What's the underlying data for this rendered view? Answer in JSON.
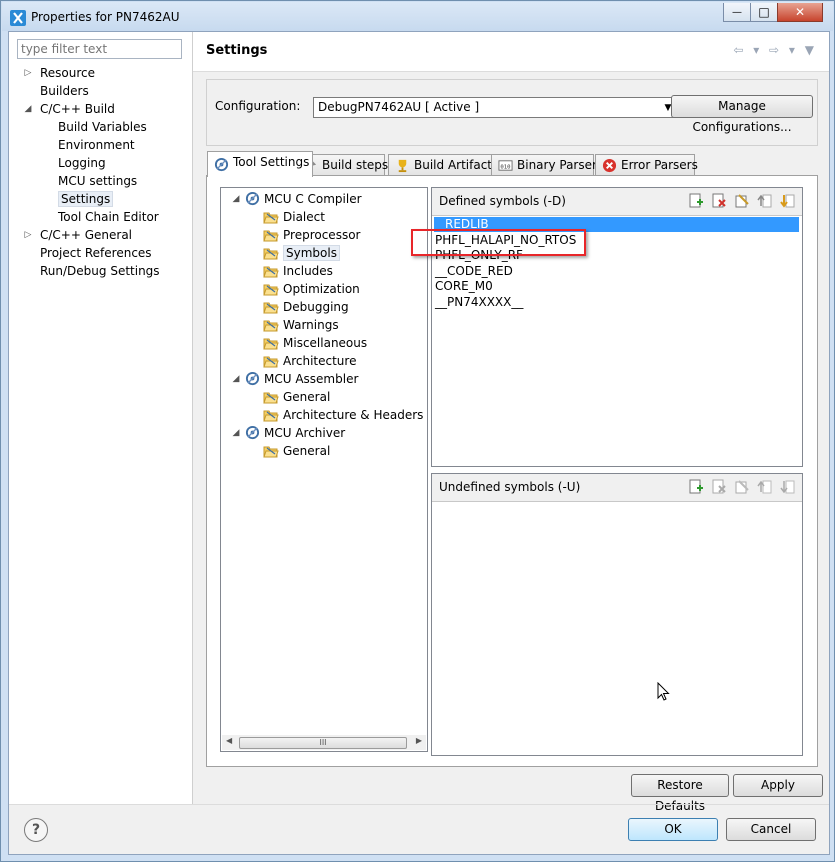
{
  "window": {
    "title": "Properties for PN7462AU",
    "minimize_glyph": "—",
    "maximize_glyph": "□",
    "close_glyph": "✕"
  },
  "left": {
    "filter_placeholder": "type filter text",
    "tree": [
      {
        "label": "Resource",
        "level": 0,
        "twisty": "▷"
      },
      {
        "label": "Builders",
        "level": 0,
        "twisty": ""
      },
      {
        "label": "C/C++ Build",
        "level": 0,
        "twisty": "◢"
      },
      {
        "label": "Build Variables",
        "level": 1,
        "twisty": ""
      },
      {
        "label": "Environment",
        "level": 1,
        "twisty": ""
      },
      {
        "label": "Logging",
        "level": 1,
        "twisty": ""
      },
      {
        "label": "MCU settings",
        "level": 1,
        "twisty": ""
      },
      {
        "label": "Settings",
        "level": 1,
        "twisty": "",
        "selected": true
      },
      {
        "label": "Tool Chain Editor",
        "level": 1,
        "twisty": ""
      },
      {
        "label": "C/C++ General",
        "level": 0,
        "twisty": "▷"
      },
      {
        "label": "Project References",
        "level": 0,
        "twisty": ""
      },
      {
        "label": "Run/Debug Settings",
        "level": 0,
        "twisty": ""
      }
    ]
  },
  "right": {
    "title": "Settings",
    "nav_glyphs": "⇦ ▾ ⇨ ▾ ▼",
    "configuration_label": "Configuration:",
    "configuration_value": "DebugPN7462AU  [ Active ]",
    "manage_button": "Manage Configurations...",
    "tabs": [
      "Tool Settings",
      "Build steps",
      "Build Artifact",
      "Binary Parsers",
      "Error Parsers"
    ],
    "tool_tree": [
      {
        "label": "MCU C Compiler",
        "kind": "tool"
      },
      {
        "label": "Dialect",
        "kind": "opt"
      },
      {
        "label": "Preprocessor",
        "kind": "opt"
      },
      {
        "label": "Symbols",
        "kind": "opt",
        "selected": true
      },
      {
        "label": "Includes",
        "kind": "opt"
      },
      {
        "label": "Optimization",
        "kind": "opt"
      },
      {
        "label": "Debugging",
        "kind": "opt"
      },
      {
        "label": "Warnings",
        "kind": "opt"
      },
      {
        "label": "Miscellaneous",
        "kind": "opt"
      },
      {
        "label": "Architecture",
        "kind": "opt"
      },
      {
        "label": "MCU Assembler",
        "kind": "tool"
      },
      {
        "label": "General",
        "kind": "opt"
      },
      {
        "label": "Architecture & Headers",
        "kind": "opt"
      },
      {
        "label": "MCU Archiver",
        "kind": "tool"
      },
      {
        "label": "General",
        "kind": "opt"
      }
    ],
    "scroll_grip": "III",
    "defined": {
      "title": "Defined symbols (-D)",
      "items": [
        "REDLIB",
        "PHFL_HALAPI_NO_RTOS",
        "PHFL_ONLY_RF",
        "__CODE_RED",
        "CORE_M0",
        "__PN74XXXX__"
      ]
    },
    "undefined": {
      "title": "Undefined symbols (-U)",
      "items": []
    },
    "restore_button": "Restore Defaults",
    "apply_button": "Apply"
  },
  "footer": {
    "help_glyph": "?",
    "ok_button": "OK",
    "cancel_button": "Cancel"
  }
}
